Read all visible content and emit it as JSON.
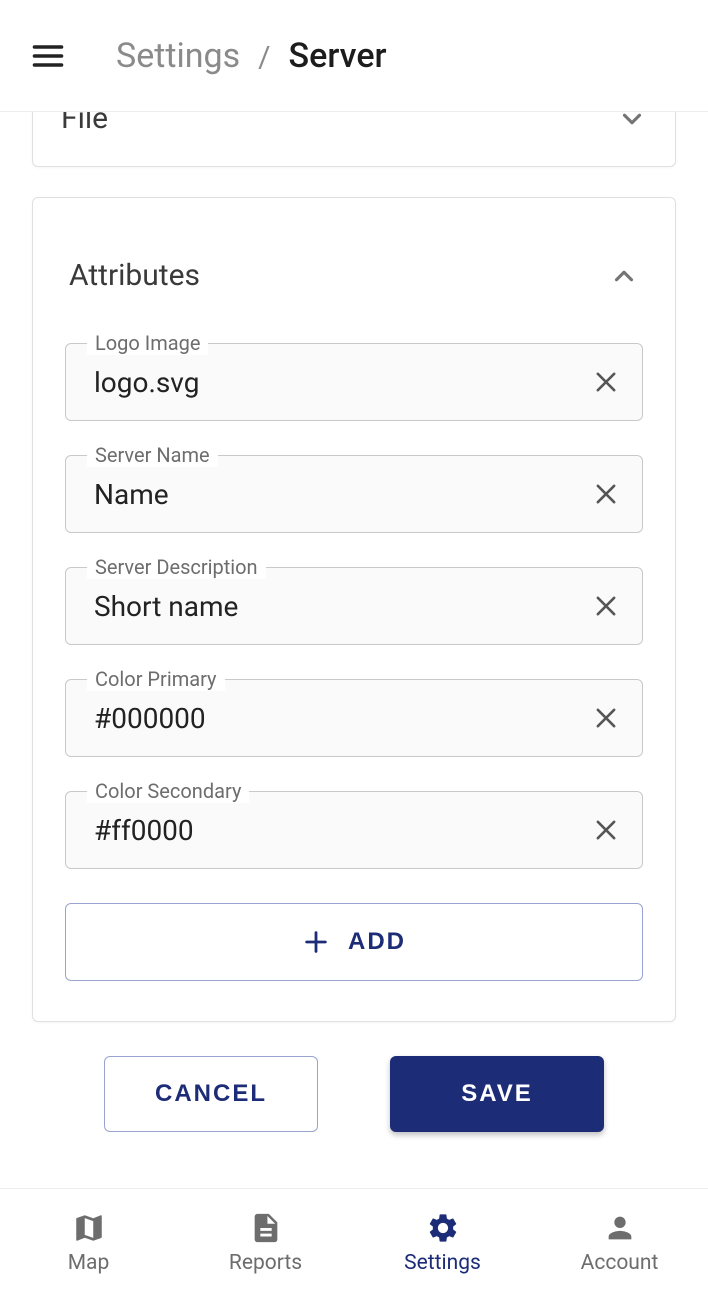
{
  "header": {
    "breadcrumb_link": "Settings",
    "breadcrumb_sep": "/",
    "breadcrumb_current": "Server"
  },
  "file_section": {
    "title": "File"
  },
  "attributes_section": {
    "title": "Attributes",
    "fields": [
      {
        "label": "Logo Image",
        "value": "logo.svg"
      },
      {
        "label": "Server Name",
        "value": "Name"
      },
      {
        "label": "Server Description",
        "value": "Short name"
      },
      {
        "label": "Color Primary",
        "value": "#000000"
      },
      {
        "label": "Color Secondary",
        "value": "#ff0000"
      }
    ],
    "add_label": "ADD"
  },
  "actions": {
    "cancel": "CANCEL",
    "save": "SAVE"
  },
  "nav": {
    "map": "Map",
    "reports": "Reports",
    "settings": "Settings",
    "account": "Account"
  }
}
